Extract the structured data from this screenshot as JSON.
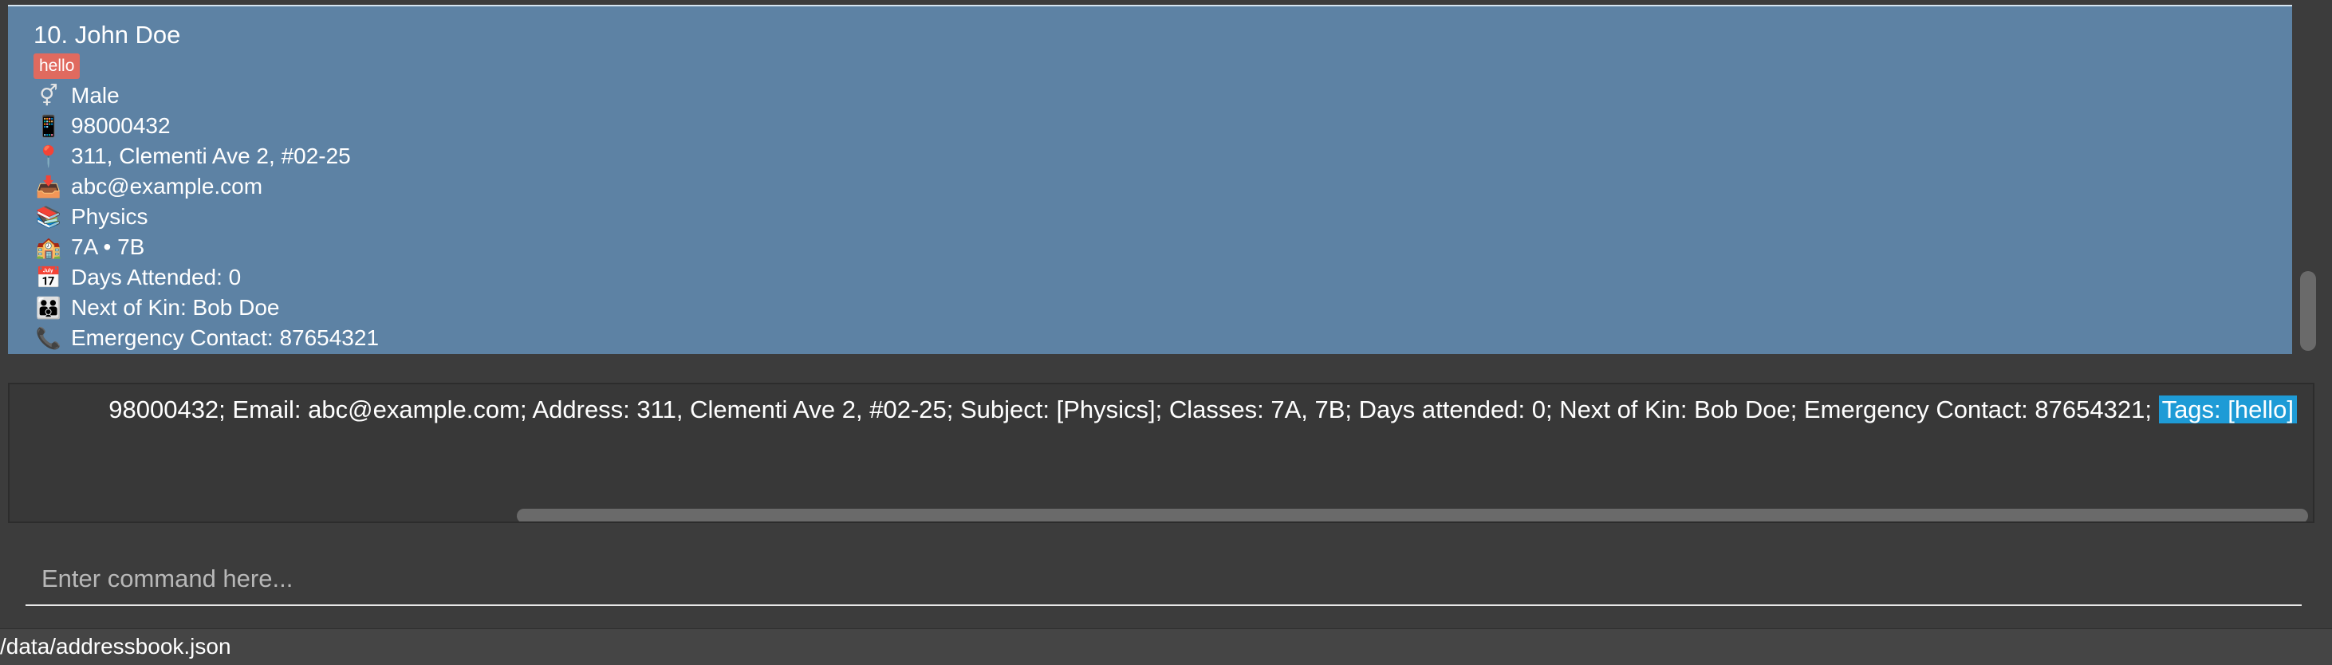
{
  "person_list": {
    "card": {
      "title": "10. John Doe",
      "tag": "hello",
      "rows": [
        {
          "icon": "gender-icon",
          "glyph": "⚥",
          "text": "Male"
        },
        {
          "icon": "mobile-phone-icon",
          "glyph": "📱",
          "text": "98000432"
        },
        {
          "icon": "location-pin-icon",
          "glyph": "📍",
          "text": "311, Clementi Ave 2, #02-25"
        },
        {
          "icon": "inbox-icon",
          "glyph": "📥",
          "text": "abc@example.com"
        },
        {
          "icon": "books-icon",
          "glyph": "📚",
          "text": "Physics"
        },
        {
          "icon": "school-icon",
          "glyph": "🏫",
          "text": "7A • 7B"
        },
        {
          "icon": "calendar-icon",
          "glyph": "📅",
          "text": "Days Attended: 0"
        },
        {
          "icon": "family-icon",
          "glyph": "👪",
          "text": "Next of Kin: Bob Doe"
        },
        {
          "icon": "telephone-icon",
          "glyph": "📞",
          "text": "Emergency Contact: 87654321"
        }
      ]
    }
  },
  "result_display": {
    "text": "98000432; Email: abc@example.com; Address: 311, Clementi Ave 2, #02-25; Subject: [Physics]; Classes: 7A, 7B; Days attended: 0; Next of Kin: Bob Doe; Emergency Contact: 87654321;",
    "highlighted": "Tags: [hello]"
  },
  "command_box": {
    "placeholder": "Enter command here..."
  },
  "status_bar": {
    "path": "/data/addressbook.json"
  },
  "colors": {
    "background": "#3c3c3c",
    "selected_card": "#5d82a4",
    "tag": "#e06a5f",
    "text_selection": "#1e9bd6"
  }
}
